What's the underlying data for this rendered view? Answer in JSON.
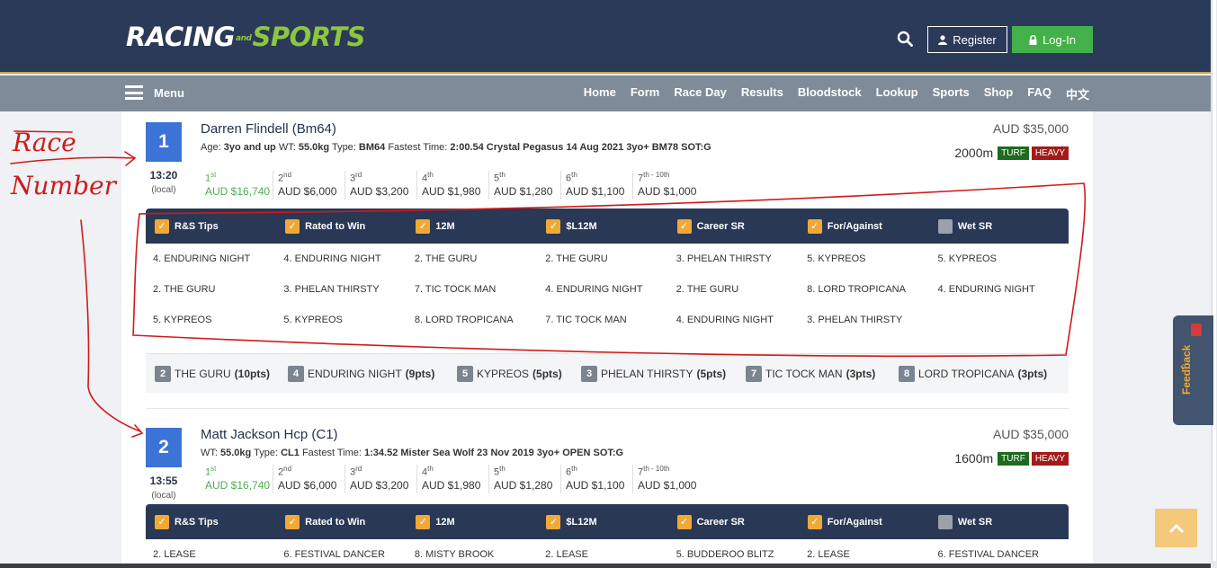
{
  "header": {
    "logo_main": "RACING",
    "logo_and": "and",
    "logo_sports": "SPORTS",
    "register_label": "Register",
    "login_label": "Log-In"
  },
  "nav": {
    "menu_label": "Menu",
    "links": [
      "Home",
      "Form",
      "Race Day",
      "Results",
      "Bloodstock",
      "Lookup",
      "Sports",
      "Shop",
      "FAQ",
      "中文"
    ]
  },
  "tip_columns": [
    "R&S Tips",
    "Rated to Win",
    "12M",
    "$L12M",
    "Career SR",
    "For/Against",
    "Wet SR"
  ],
  "tip_checked": [
    true,
    true,
    true,
    true,
    true,
    true,
    false
  ],
  "races": [
    {
      "number": "1",
      "time": "13:20",
      "tz": "(local)",
      "name": "Darren Flindell (Bm64)",
      "info_age_label": "Age:",
      "info_age": "3yo and up",
      "info_wt_label": "WT:",
      "info_wt": "55.0kg",
      "info_type_label": "Type:",
      "info_type": "BM64",
      "info_fastest_label": "Fastest Time:",
      "info_fastest": "2:00.54 Crystal Pegasus 14 Aug 2021 3yo+ BM78 SOT:G",
      "prize_total": "AUD $35,000",
      "distance": "2000m",
      "surface": "TURF",
      "condition": "HEAVY",
      "places": [
        {
          "n": "1",
          "suf": "st",
          "value": "AUD $16,740"
        },
        {
          "n": "2",
          "suf": "nd",
          "value": "AUD $6,000"
        },
        {
          "n": "3",
          "suf": "rd",
          "value": "AUD $3,200"
        },
        {
          "n": "4",
          "suf": "th",
          "value": "AUD $1,980"
        },
        {
          "n": "5",
          "suf": "th",
          "value": "AUD $1,280"
        },
        {
          "n": "6",
          "suf": "th",
          "value": "AUD $1,100"
        },
        {
          "n": "7",
          "suf": "th - 10",
          "suf2": "th",
          "value": "AUD $1,000"
        }
      ],
      "tips_rows": [
        [
          "4. ENDURING NIGHT",
          "4. ENDURING NIGHT",
          "2. THE GURU",
          "2. THE GURU",
          "3. PHELAN THIRSTY",
          "5. KYPREOS",
          "5. KYPREOS"
        ],
        [
          "2. THE GURU",
          "3. PHELAN THIRSTY",
          "7. TIC TOCK MAN",
          "4. ENDURING NIGHT",
          "2. THE GURU",
          "8. LORD TROPICANA",
          "4. ENDURING NIGHT"
        ],
        [
          "5. KYPREOS",
          "5. KYPREOS",
          "8. LORD TROPICANA",
          "7. TIC TOCK MAN",
          "4. ENDURING NIGHT",
          "3. PHELAN THIRSTY",
          ""
        ]
      ],
      "consensus": [
        {
          "num": "2",
          "name": "THE GURU",
          "pts": "(10pts)"
        },
        {
          "num": "4",
          "name": "ENDURING NIGHT",
          "pts": "(9pts)"
        },
        {
          "num": "5",
          "name": "KYPREOS",
          "pts": "(5pts)"
        },
        {
          "num": "3",
          "name": "PHELAN THIRSTY",
          "pts": "(5pts)"
        },
        {
          "num": "7",
          "name": "TIC TOCK MAN",
          "pts": "(3pts)"
        },
        {
          "num": "8",
          "name": "LORD TROPICANA",
          "pts": "(3pts)"
        }
      ]
    },
    {
      "number": "2",
      "time": "13:55",
      "tz": "(local)",
      "name": "Matt Jackson Hcp (C1)",
      "info_wt_label": "WT:",
      "info_wt": "55.0kg",
      "info_type_label": "Type:",
      "info_type": "CL1",
      "info_fastest_label": "Fastest Time:",
      "info_fastest": "1:34.52 Mister Sea Wolf 23 Nov 2019 3yo+ OPEN SOT:G",
      "prize_total": "AUD $35,000",
      "distance": "1600m",
      "surface": "TURF",
      "condition": "HEAVY",
      "places": [
        {
          "n": "1",
          "suf": "st",
          "value": "AUD $16,740"
        },
        {
          "n": "2",
          "suf": "nd",
          "value": "AUD $6,000"
        },
        {
          "n": "3",
          "suf": "rd",
          "value": "AUD $3,200"
        },
        {
          "n": "4",
          "suf": "th",
          "value": "AUD $1,980"
        },
        {
          "n": "5",
          "suf": "th",
          "value": "AUD $1,280"
        },
        {
          "n": "6",
          "suf": "th",
          "value": "AUD $1,100"
        },
        {
          "n": "7",
          "suf": "th - 10",
          "suf2": "th",
          "value": "AUD $1,000"
        }
      ],
      "tips_rows": [
        [
          "2. LEASE",
          "6. FESTIVAL DANCER",
          "8. MISTY BROOK",
          "2. LEASE",
          "5. BUDDEROO BLITZ",
          "2. LEASE",
          "6. FESTIVAL DANCER"
        ]
      ]
    }
  ],
  "feedback_label": "Feedback",
  "annotation": {
    "line1": "Race",
    "line2": "Number",
    "color": "#d01b1b"
  },
  "colors": {
    "header_bg": "#2b3a58",
    "nav_bg": "#7f8b99",
    "race_badge": "#3b74d6",
    "tips_header": "#283855",
    "checkbox": "#f0a937",
    "login_green": "#43b149",
    "turf": "#1d6b1f",
    "heavy": "#a31a1a"
  }
}
